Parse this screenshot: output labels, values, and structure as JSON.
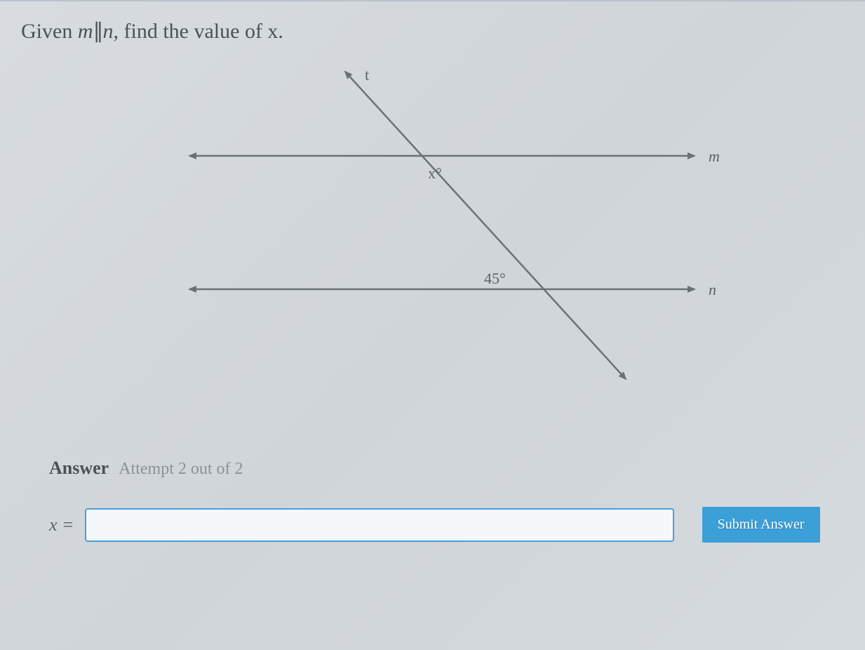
{
  "question": {
    "prefix": "Given ",
    "var1": "m",
    "var2": "n",
    "suffix": ", find the value of x."
  },
  "diagram": {
    "line_m_label": "m",
    "line_n_label": "n",
    "transversal_label": "t",
    "angle_x_label": "x°",
    "angle_given_label": "45°"
  },
  "answer": {
    "section_label": "Answer",
    "attempt_text": "Attempt 2 out of 2",
    "variable_label": "x =",
    "input_value": "",
    "submit_label": "Submit Answer"
  }
}
